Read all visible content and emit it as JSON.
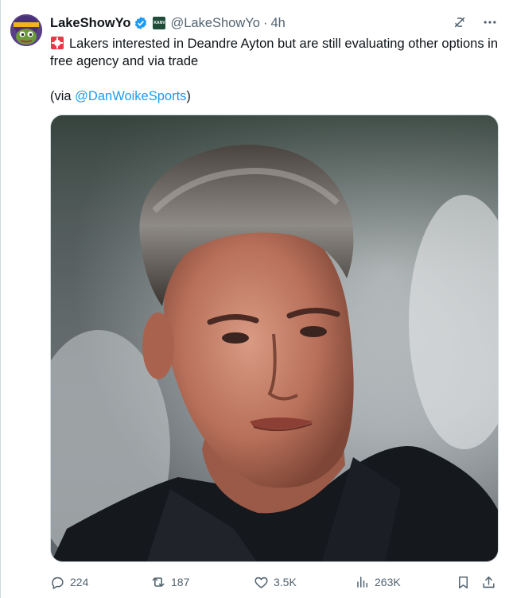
{
  "tweet": {
    "display_name": "LakeShowYo",
    "handle": "@LakeShowYo",
    "separator": "·",
    "time": "4h",
    "affiliate_label": "KANV",
    "text": "Lakers interested in Deandre Ayton but are still evaluating other options in free agency and via trade",
    "via_prefix": "(via ",
    "via_mention": "@DanWoikeSports",
    "via_suffix": ")",
    "media_alt": "Photo of a man with short graying hair in a dark jacket"
  },
  "actions": {
    "replies": "224",
    "reposts": "187",
    "likes": "3.5K",
    "views": "263K"
  },
  "colors": {
    "text": "#0f1419",
    "secondary": "#536471",
    "link": "#1d9bf0",
    "verified": "#1d9bf0"
  },
  "icons": [
    "verified-badge-icon",
    "grok-icon",
    "more-icon",
    "reply-icon",
    "repost-icon",
    "like-icon",
    "views-icon",
    "bookmark-icon",
    "share-icon",
    "alert-light-emoji"
  ]
}
